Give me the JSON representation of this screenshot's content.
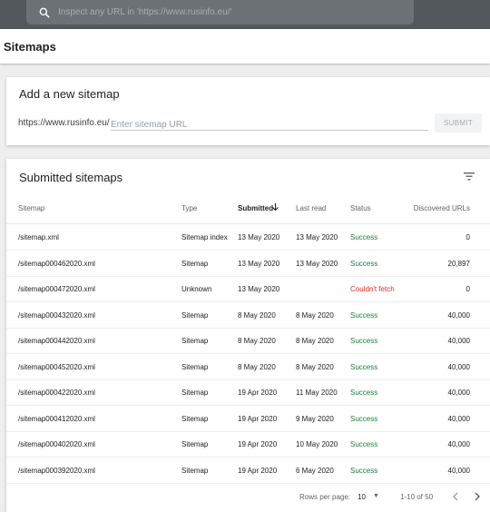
{
  "topbar": {
    "search_placeholder": "Inspect any URL in 'https://www.rusinfo.eu/'"
  },
  "header": {
    "title": "Sitemaps"
  },
  "add_sitemap": {
    "title": "Add a new sitemap",
    "prefix": "https://www.rusinfo.eu/",
    "input_placeholder": "Enter sitemap URL",
    "input_value": "",
    "submit_label": "SUBMIT"
  },
  "submitted": {
    "title": "Submitted sitemaps",
    "columns": [
      "Sitemap",
      "Type",
      "Submitted",
      "Last read",
      "Status",
      "Discovered URLs"
    ],
    "sort_icon": "arrow-down-icon",
    "rows": [
      [
        "/sitemap.xml",
        "Sitemap index",
        "13 May 2020",
        "13 May 2020",
        "Success",
        "0"
      ],
      [
        "/sitemap000462020.xml",
        "Sitemap",
        "13 May 2020",
        "13 May 2020",
        "Success",
        "20,897"
      ],
      [
        "/sitemap000472020.xml",
        "Unknown",
        "13 May 2020",
        "",
        "Couldn't fetch",
        "0"
      ],
      [
        "/sitemap000432020.xml",
        "Sitemap",
        "8 May 2020",
        "8 May 2020",
        "Success",
        "40,000"
      ],
      [
        "/sitemap000442020.xml",
        "Sitemap",
        "8 May 2020",
        "8 May 2020",
        "Success",
        "40,000"
      ],
      [
        "/sitemap000452020.xml",
        "Sitemap",
        "8 May 2020",
        "8 May 2020",
        "Success",
        "40,000"
      ],
      [
        "/sitemap000422020.xml",
        "Sitemap",
        "19 Apr 2020",
        "11 May 2020",
        "Success",
        "40,000"
      ],
      [
        "/sitemap000412020.xml",
        "Sitemap",
        "19 Apr 2020",
        "9 May 2020",
        "Success",
        "40,000"
      ],
      [
        "/sitemap000402020.xml",
        "Sitemap",
        "19 Apr 2020",
        "10 May 2020",
        "Success",
        "40,000"
      ],
      [
        "/sitemap000392020.xml",
        "Sitemap",
        "19 Apr 2020",
        "6 May 2020",
        "Success",
        "40,000"
      ]
    ],
    "footer": {
      "rows_per_page_label": "Rows per page:",
      "rows_per_page_value": "10",
      "range": "1-10 of 50"
    }
  },
  "colors": {
    "success": "#188038",
    "error": "#d93025",
    "topbar": "#52585c"
  }
}
